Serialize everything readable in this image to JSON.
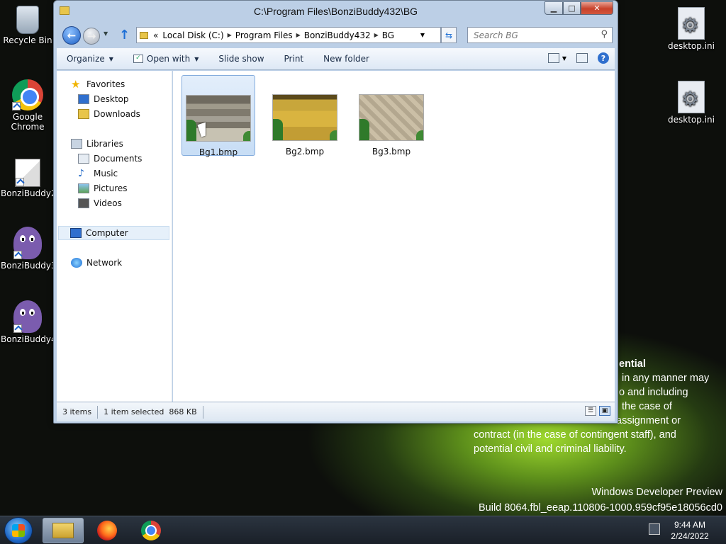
{
  "window": {
    "title": "C:\\Program Files\\BonziBuddy432\\BG",
    "caption": {
      "minimize": "▁",
      "maximize": "□",
      "close": "✕"
    }
  },
  "address": {
    "overflow": "«",
    "segments": [
      "Local Disk (C:)",
      "Program Files",
      "BonziBuddy432",
      "BG"
    ]
  },
  "search": {
    "placeholder": "Search BG"
  },
  "toolbar": {
    "organize": "Organize",
    "open_with": "Open with",
    "slide_show": "Slide show",
    "print": "Print",
    "new_folder": "New folder"
  },
  "nav_pane": {
    "favorites": "Favorites",
    "desktop": "Desktop",
    "downloads": "Downloads",
    "libraries": "Libraries",
    "documents": "Documents",
    "music": "Music",
    "pictures": "Pictures",
    "videos": "Videos",
    "computer": "Computer",
    "network": "Network"
  },
  "files": [
    {
      "name": "Bg1.bmp",
      "selected": true
    },
    {
      "name": "Bg2.bmp",
      "selected": false
    },
    {
      "name": "Bg3.bmp",
      "selected": false
    }
  ],
  "status": {
    "count": "3 items",
    "selection": "1 item selected",
    "size": "868 KB"
  },
  "desktop_icons": {
    "recycle_bin": "Recycle Bin",
    "chrome": "Google Chrome",
    "bonzi2": "BonziBuddy2",
    "bonzi3": "BonziBuddy3",
    "bonzi4": "BonziBuddy4",
    "ini1": "desktop.ini",
    "ini2": "desktop.ini"
  },
  "watermark": {
    "heading": "ential",
    "lines": [
      "in any manner may",
      "o and including",
      "the case of",
      "assignment or",
      "contract (in the case of contingent staff), and",
      "potential civil and criminal liability."
    ]
  },
  "build": {
    "line1": "Windows Developer Preview",
    "line2": "Build 8064.fbl_eeap.110806-1000.959cf95e18056cd0"
  },
  "clock": {
    "time": "9:44 AM",
    "date": "2/24/2022"
  }
}
